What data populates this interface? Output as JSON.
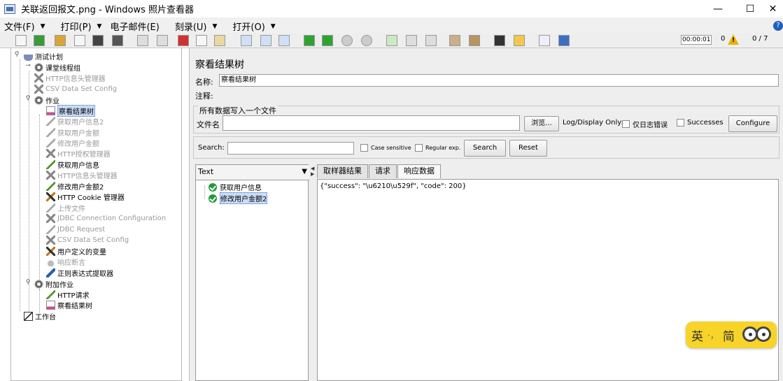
{
  "window": {
    "title": "关联返回报文.png - Windows 照片查看器",
    "minimize": "—",
    "maximize": "☐",
    "close": "✕"
  },
  "menu": {
    "items": [
      {
        "label": "文件(F)",
        "caret": "▼"
      },
      {
        "label": "打印(P)",
        "caret": "▼"
      },
      {
        "label": "电子邮件(E)",
        "caret": ""
      },
      {
        "label": "刻录(U)",
        "caret": "▼"
      },
      {
        "label": "打开(O)",
        "caret": "▼"
      }
    ]
  },
  "toolbar": {
    "timer": "00:00:01",
    "errors": "0",
    "threads": "0 / 7"
  },
  "tree": {
    "items": [
      {
        "label": "测试计划",
        "icon": "flask-icon",
        "disabled": false
      },
      {
        "label": "课堂线程组",
        "icon": "gear-icon",
        "disabled": false
      },
      {
        "label": "HTTP信息头管理器",
        "icon": "tools-icon",
        "disabled": true
      },
      {
        "label": "CSV Data Set Config",
        "icon": "tools-icon",
        "disabled": true
      },
      {
        "label": "作业",
        "icon": "gear-icon",
        "disabled": false
      },
      {
        "label": "察看结果树",
        "icon": "chart-icon",
        "disabled": false,
        "selected": true
      },
      {
        "label": "获取用户信息2",
        "icon": "pen-icon",
        "disabled": true
      },
      {
        "label": "获取用户金额",
        "icon": "pen-icon",
        "disabled": true
      },
      {
        "label": "修改用户金额",
        "icon": "pen-icon",
        "disabled": true
      },
      {
        "label": "HTTP授权管理器",
        "icon": "tools-icon",
        "disabled": true
      },
      {
        "label": "获取用户信息",
        "icon": "pen-icon",
        "disabled": false
      },
      {
        "label": "HTTP信息头管理器",
        "icon": "tools-icon",
        "disabled": true
      },
      {
        "label": "修改用户金额2",
        "icon": "pen-icon",
        "disabled": false
      },
      {
        "label": "HTTP Cookie 管理器",
        "icon": "tools-icon",
        "disabled": false
      },
      {
        "label": "上传文件",
        "icon": "pen-icon",
        "disabled": true
      },
      {
        "label": "JDBC Connection Configuration",
        "icon": "tools-icon",
        "disabled": true
      },
      {
        "label": "JDBC Request",
        "icon": "pen-icon",
        "disabled": true
      },
      {
        "label": "CSV Data Set Config",
        "icon": "tools-icon",
        "disabled": true
      },
      {
        "label": "用户定义的变量",
        "icon": "tools-icon",
        "disabled": false
      },
      {
        "label": "响应断言",
        "icon": "assertion-icon",
        "disabled": true
      },
      {
        "label": "正则表达式提取器",
        "icon": "arrow-icon",
        "disabled": false
      },
      {
        "label": "附加作业",
        "icon": "gear-icon",
        "disabled": false
      },
      {
        "label": "HTTP请求",
        "icon": "pen-icon",
        "disabled": false
      },
      {
        "label": "察看结果树",
        "icon": "chart-icon",
        "disabled": false
      },
      {
        "label": "工作台",
        "icon": "workbench-icon",
        "disabled": false
      }
    ]
  },
  "panel": {
    "title": "察看结果树",
    "name_label": "名称:",
    "name_value": "察看结果树",
    "comment_label": "注释:",
    "comment_value": "",
    "file_group_title": "所有数据写入一个文件",
    "filename_label": "文件名",
    "filename_value": "",
    "browse_label": "浏览...",
    "log_display_label": "Log/Display Only:",
    "errors_only_label": "仅日志错误",
    "successes_label": "Successes",
    "configure_label": "Configure",
    "search_label": "Search:",
    "search_value": "",
    "case_sensitive_label": "Case sensitive",
    "regular_exp_label": "Regular exp.",
    "search_button": "Search",
    "reset_button": "Reset"
  },
  "results": {
    "renderer": "Text",
    "samples": [
      {
        "label": "获取用户信息",
        "selected": false
      },
      {
        "label": "修改用户金额2",
        "selected": true
      }
    ],
    "tabs": [
      "取样器结果",
      "请求",
      "响应数据"
    ],
    "active_tab": "响应数据",
    "response_body": "{\"success\": \"\\u6210\\u529f\", \"code\": 200}"
  },
  "ime": {
    "lang": "英",
    "separator": "·，",
    "mode": "简"
  }
}
